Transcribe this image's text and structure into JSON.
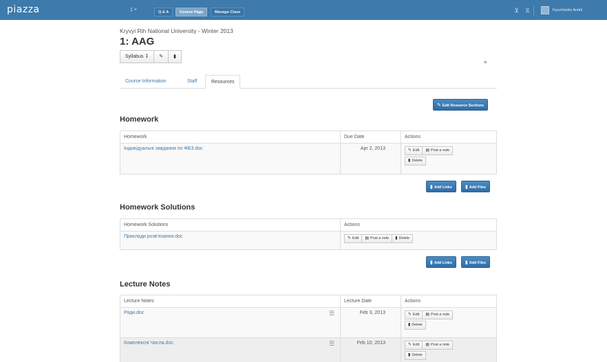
{
  "topbar": {
    "logo": "piazza",
    "class_selector": "1 ˅",
    "nav": [
      "Q & A",
      "Course Page",
      "Manage Class"
    ],
    "user_name": "Kyrychenko Andrii"
  },
  "course": {
    "university": "Kryvyi Rih National University - Winter 2013",
    "title": "1: AAG",
    "syllabus_label": "Syllabus",
    "tabs": [
      "Course Information",
      "Staff",
      "Resources"
    ]
  },
  "actions": {
    "edit_sections": "Edit Resource Sections",
    "add_links": "Add Links",
    "add_files": "Add Files",
    "edit": "Edit",
    "post_note": "Post a note",
    "delete": "Delete"
  },
  "homework": {
    "title": "Homework",
    "columns": [
      "Homework",
      "Due Date",
      "Actions"
    ],
    "rows": [
      {
        "name": "Індивідуальні завдання по ФБЗ.doc",
        "date": "Apr 2, 2013"
      }
    ]
  },
  "homework_solutions": {
    "title": "Homework Solutions",
    "columns": [
      "Homework Solutions",
      "Actions"
    ],
    "rows": [
      {
        "name": "Приклади розв'язання.doc"
      }
    ]
  },
  "lecture_notes": {
    "title": "Lecture Notes",
    "columns": [
      "Lecture Notes",
      "Lecture Date",
      "Actions"
    ],
    "rows": [
      {
        "name": "Ряди.doc",
        "date": "Feb 3, 2013"
      },
      {
        "name": "Комплексні Числа.doc",
        "date": "Feb 10, 2013"
      }
    ]
  }
}
